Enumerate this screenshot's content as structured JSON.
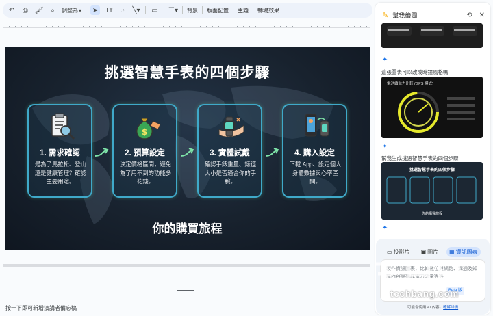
{
  "toolbar": {
    "zoom_label": "調整為",
    "background": "背景",
    "layout": "版面配置",
    "theme": "主題",
    "transition": "轉場效果"
  },
  "slide": {
    "title": "挑選智慧手表的四個步驟",
    "cards": [
      {
        "title": "1. 需求確認",
        "desc": "是為了馬拉松、登山還是健康管理？確認主要用途。",
        "icon": "clipboard-magnifier-icon"
      },
      {
        "title": "2. 預算設定",
        "desc": "決定價格區間，避免為了用不到的功能多花錢。",
        "icon": "money-bag-icon"
      },
      {
        "title": "3. 實體試戴",
        "desc": "確認手錶重量、錶徑大小是否適合你的手腕。",
        "icon": "wrist-watch-icon"
      },
      {
        "title": "4. 購入設定",
        "desc": "下載 App、設定個人身體數據與心率區間。",
        "icon": "phone-watch-sync-icon"
      }
    ],
    "footer": "你的購買旅程",
    "colors": {
      "card_border": "#3fa9c9",
      "card_glow": "#5ed6a0",
      "arrow": "#7ee3a8"
    }
  },
  "notes": {
    "placeholder": "按一下即可新增演講者備忘稿"
  },
  "panel": {
    "title": "幫我繪圖",
    "caption1": "這張圖表可以改成時鐘風格嗎",
    "thumb2_title": "電池續航力比較 (GPS 模式)",
    "caption2": "幫我生成挑選智慧手表的四個步驟",
    "thumb3_title": "挑選智慧手表的四個步驟",
    "thumb3_footer": "你的購買旅程",
    "tabs": [
      "投影片",
      "圖片",
      "資訊圖表"
    ],
    "active_tab": "資訊圖表",
    "input_placeholder": "製作資訊圖表，比較數位與網路、溝通及知識內容等構成電力總量等等",
    "beta": "Beta 版",
    "footer_prefix": "可能會使用 AI 內容。",
    "footer_link": "瞭解詳情"
  },
  "watermark": {
    "text": "techbang.com"
  }
}
